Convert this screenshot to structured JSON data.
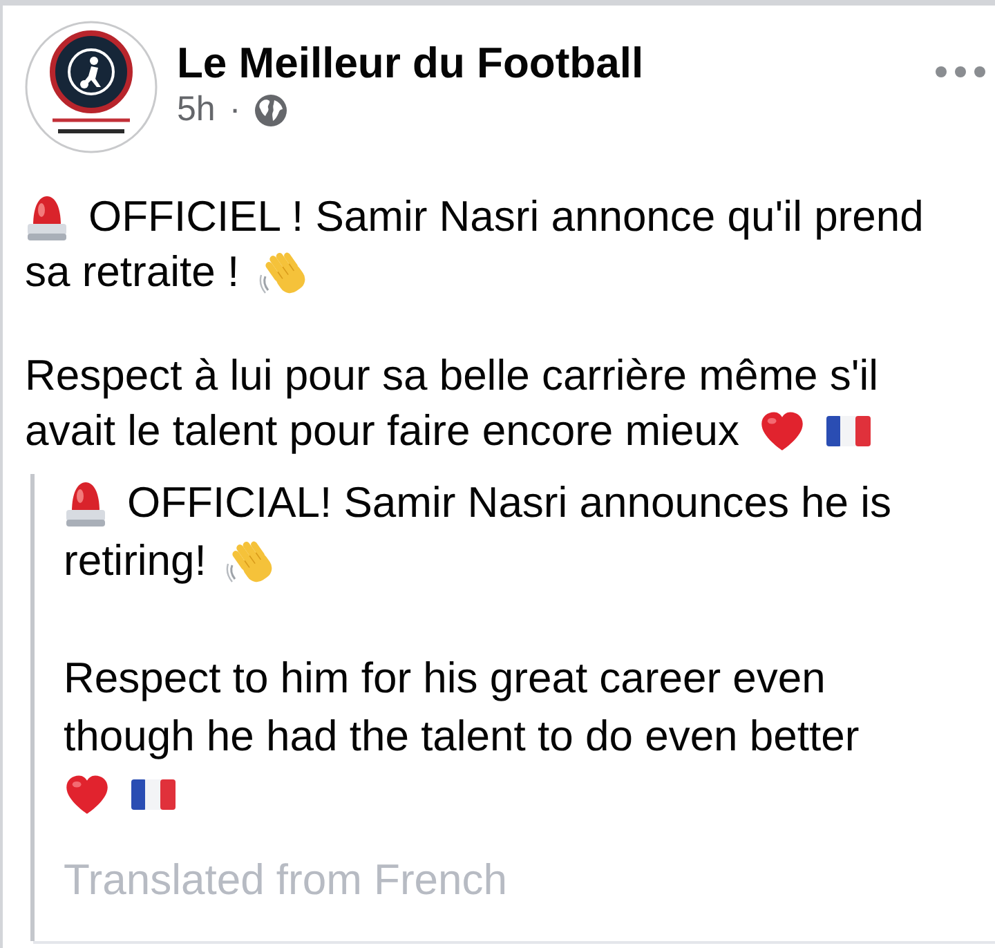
{
  "post": {
    "page_name": "Le Meilleur du Football",
    "time": "5h",
    "separator": "·",
    "paragraphs": [
      {
        "lines": [
          {
            "segments": [
              {
                "kind": "siren"
              },
              {
                "kind": "text",
                "text": "OFFICIEL ! Samir Nasri annonce qu'il prend"
              }
            ]
          },
          {
            "segments": [
              {
                "kind": "text",
                "text": "sa retraite !"
              },
              {
                "kind": "wave"
              }
            ]
          }
        ]
      },
      {
        "lines": [
          {
            "segments": [
              {
                "kind": "text",
                "text": "Respect à lui pour sa belle carrière même s'il"
              }
            ]
          },
          {
            "segments": [
              {
                "kind": "text",
                "text": "avait le talent pour faire encore mieux"
              },
              {
                "kind": "heart"
              },
              {
                "kind": "flag"
              }
            ]
          }
        ]
      }
    ],
    "translation": {
      "paragraphs": [
        {
          "lines": [
            {
              "segments": [
                {
                  "kind": "siren"
                },
                {
                  "kind": "text",
                  "text": "OFFICIAL! Samir Nasri announces he is"
                }
              ]
            },
            {
              "segments": [
                {
                  "kind": "text",
                  "text": "retiring!"
                },
                {
                  "kind": "wave"
                }
              ]
            }
          ]
        },
        {
          "lines": [
            {
              "segments": [
                {
                  "kind": "text",
                  "text": "Respect to him for his great career even"
                }
              ]
            },
            {
              "segments": [
                {
                  "kind": "text",
                  "text": "though he had the talent to do even better"
                }
              ]
            },
            {
              "segments": [
                {
                  "kind": "heart"
                },
                {
                  "kind": "flag"
                }
              ]
            }
          ]
        }
      ],
      "note": "Translated from French"
    }
  }
}
